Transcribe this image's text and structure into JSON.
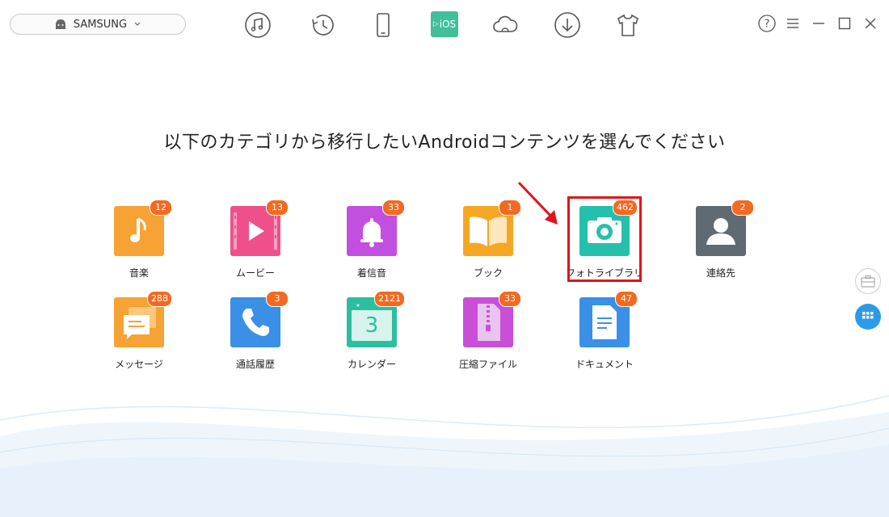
{
  "device": {
    "name": "SAMSUNG"
  },
  "toolbar": {
    "ios_label": "iOS",
    "items": [
      "music-icon",
      "history-icon",
      "phone-icon",
      "ios-icon",
      "cloud-icon",
      "download-icon",
      "tshirt-icon"
    ]
  },
  "window_controls": [
    "help-icon",
    "menu-icon",
    "minimize-icon",
    "maximize-icon",
    "close-icon"
  ],
  "headline": "以下のカテゴリから移行したいAndroidコンテンツを選んでください",
  "categories": [
    {
      "label": "音楽",
      "count": "12"
    },
    {
      "label": "ムービー",
      "count": "13"
    },
    {
      "label": "着信音",
      "count": "33"
    },
    {
      "label": "ブック",
      "count": "1"
    },
    {
      "label": "フォトライブラリ",
      "count": "462"
    },
    {
      "label": "連絡先",
      "count": "2"
    },
    {
      "label": "メッセージ",
      "count": "288"
    },
    {
      "label": "通話履歴",
      "count": "3"
    },
    {
      "label": "カレンダー",
      "count": "2121"
    },
    {
      "label": "圧縮ファイル",
      "count": "33"
    },
    {
      "label": "ドキュメント",
      "count": "47"
    }
  ],
  "calendar_day": "3",
  "colors": {
    "badge": "#f26a21",
    "highlight": "#e0141b",
    "ios_accent": "#3fbf9a",
    "side_active": "#2c9ae8"
  }
}
